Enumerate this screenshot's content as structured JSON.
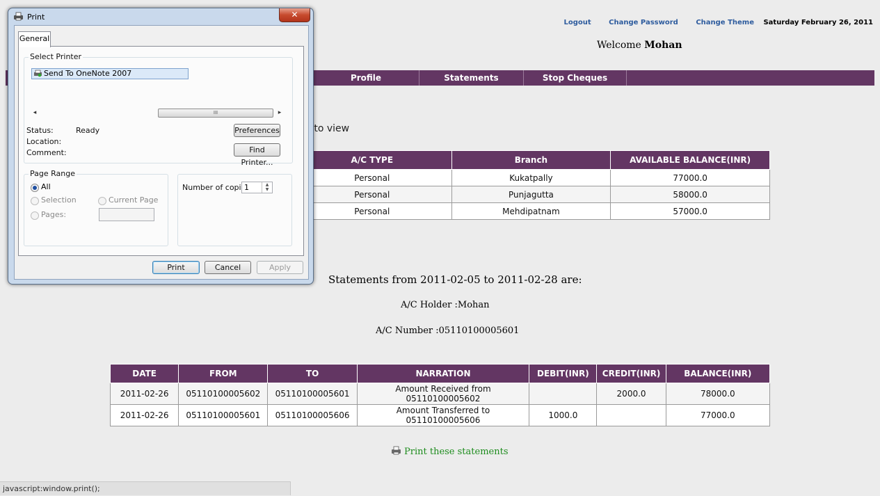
{
  "header": {
    "links": {
      "logout": "Logout",
      "change_password": "Change Password",
      "change_theme": "Change Theme"
    },
    "date": "Saturday February 26, 2011",
    "welcome_prefix": "Welcome",
    "welcome_name": "Mohan"
  },
  "nav": {
    "items": [
      "Profile",
      "Statements",
      "Stop Cheques"
    ]
  },
  "account_select_text": "h to view",
  "accounts_table": {
    "columns": [
      "A/C TYPE",
      "Branch",
      "AVAILABLE BALANCE(INR)"
    ],
    "rows": [
      [
        "Personal",
        "Kukatpally",
        "77000.0"
      ],
      [
        "Personal",
        "Punjagutta",
        "58000.0"
      ],
      [
        "Personal",
        "Mehdipatnam",
        "57000.0"
      ]
    ]
  },
  "statement": {
    "title": "Statements from 2011-02-05 to 2011-02-28 are:",
    "holder": "A/C Holder :Mohan",
    "number": "A/C Number :05110100005601"
  },
  "statement_table": {
    "columns": [
      "DATE",
      "FROM",
      "TO",
      "NARRATION",
      "DEBIT(INR)",
      "CREDIT(INR)",
      "BALANCE(INR)"
    ],
    "rows": [
      [
        "2011-02-26",
        "05110100005602",
        "05110100005601",
        "Amount Received from 05110100005602",
        "",
        "2000.0",
        "78000.0"
      ],
      [
        "2011-02-26",
        "05110100005601",
        "05110100005606",
        "Amount Transferred to 05110100005606",
        "1000.0",
        "",
        "77000.0"
      ]
    ]
  },
  "print_link": "Print these statements",
  "statusbar": "javascript:window.print();",
  "print_dialog": {
    "title": "Print",
    "close": "✕",
    "tab": "General",
    "select_printer_label": "Select Printer",
    "printer": "Send To OneNote 2007",
    "scroll_thumb": "III",
    "status_label": "Status:",
    "status_value": "Ready",
    "location_label": "Location:",
    "comment_label": "Comment:",
    "preferences_button": "Preferences",
    "find_printer_button": "Find Printer...",
    "page_range_label": "Page Range",
    "all_label": "All",
    "selection_label": "Selection",
    "current_page_label": "Current Page",
    "pages_label": "Pages:",
    "copies_label": "Number of copies:",
    "copies_value": "1",
    "print_button": "Print",
    "cancel_button": "Cancel",
    "apply_button": "Apply"
  }
}
